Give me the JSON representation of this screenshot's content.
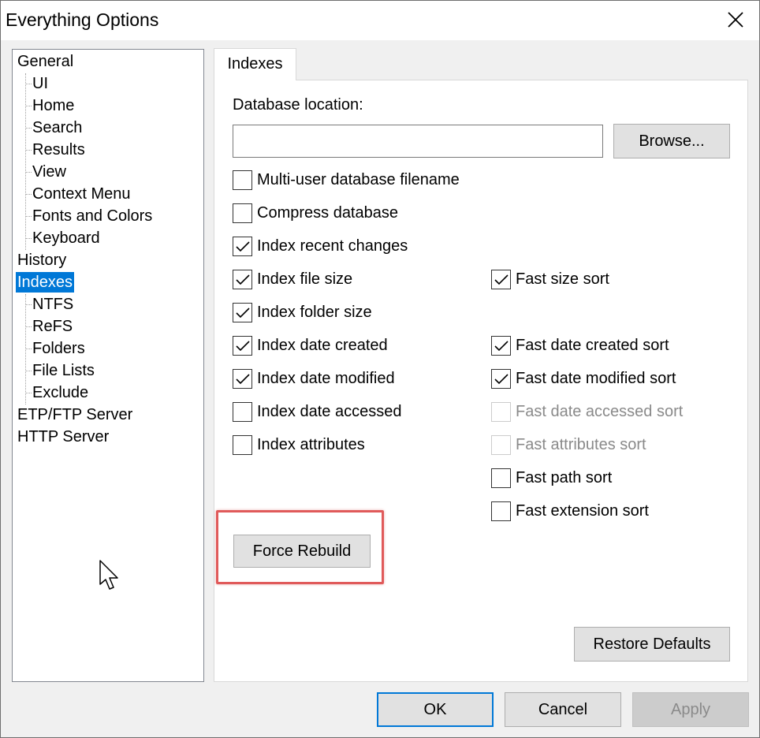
{
  "window": {
    "title": "Everything Options"
  },
  "tree": [
    {
      "label": "General",
      "level": 0,
      "selected": false
    },
    {
      "label": "UI",
      "level": 1,
      "selected": false
    },
    {
      "label": "Home",
      "level": 1,
      "selected": false
    },
    {
      "label": "Search",
      "level": 1,
      "selected": false
    },
    {
      "label": "Results",
      "level": 1,
      "selected": false
    },
    {
      "label": "View",
      "level": 1,
      "selected": false
    },
    {
      "label": "Context Menu",
      "level": 1,
      "selected": false
    },
    {
      "label": "Fonts and Colors",
      "level": 1,
      "selected": false
    },
    {
      "label": "Keyboard",
      "level": 1,
      "selected": false
    },
    {
      "label": "History",
      "level": 0,
      "selected": false
    },
    {
      "label": "Indexes",
      "level": 0,
      "selected": true
    },
    {
      "label": "NTFS",
      "level": 1,
      "selected": false
    },
    {
      "label": "ReFS",
      "level": 1,
      "selected": false
    },
    {
      "label": "Folders",
      "level": 1,
      "selected": false
    },
    {
      "label": "File Lists",
      "level": 1,
      "selected": false
    },
    {
      "label": "Exclude",
      "level": 1,
      "selected": false
    },
    {
      "label": "ETP/FTP Server",
      "level": 0,
      "selected": false
    },
    {
      "label": "HTTP Server",
      "level": 0,
      "selected": false
    }
  ],
  "tab": {
    "label": "Indexes"
  },
  "indexes": {
    "db_location_label": "Database location:",
    "db_location_value": "",
    "browse_label": "Browse...",
    "checkboxes_left": [
      {
        "label": "Multi-user database filename",
        "checked": false,
        "disabled": false
      },
      {
        "label": "Compress database",
        "checked": false,
        "disabled": false
      },
      {
        "label": "Index recent changes",
        "checked": true,
        "disabled": false
      },
      {
        "label": "Index file size",
        "checked": true,
        "disabled": false
      },
      {
        "label": "Index folder size",
        "checked": true,
        "disabled": false
      },
      {
        "label": "Index date created",
        "checked": true,
        "disabled": false
      },
      {
        "label": "Index date modified",
        "checked": true,
        "disabled": false
      },
      {
        "label": "Index date accessed",
        "checked": false,
        "disabled": false
      },
      {
        "label": "Index attributes",
        "checked": false,
        "disabled": false
      }
    ],
    "checkboxes_right": [
      {
        "label": "Fast size sort",
        "checked": true,
        "disabled": false
      },
      {
        "label": "Fast date created sort",
        "checked": true,
        "disabled": false
      },
      {
        "label": "Fast date modified sort",
        "checked": true,
        "disabled": false
      },
      {
        "label": "Fast date accessed sort",
        "checked": false,
        "disabled": true
      },
      {
        "label": "Fast attributes sort",
        "checked": false,
        "disabled": true
      },
      {
        "label": "Fast path sort",
        "checked": false,
        "disabled": false
      },
      {
        "label": "Fast extension sort",
        "checked": false,
        "disabled": false
      }
    ],
    "force_rebuild_label": "Force Rebuild",
    "restore_defaults_label": "Restore Defaults"
  },
  "footer": {
    "ok_label": "OK",
    "cancel_label": "Cancel",
    "apply_label": "Apply"
  },
  "colors": {
    "selection": "#0078d7",
    "highlight_box": "#e05a5a",
    "default_button_border": "#0078d7"
  }
}
